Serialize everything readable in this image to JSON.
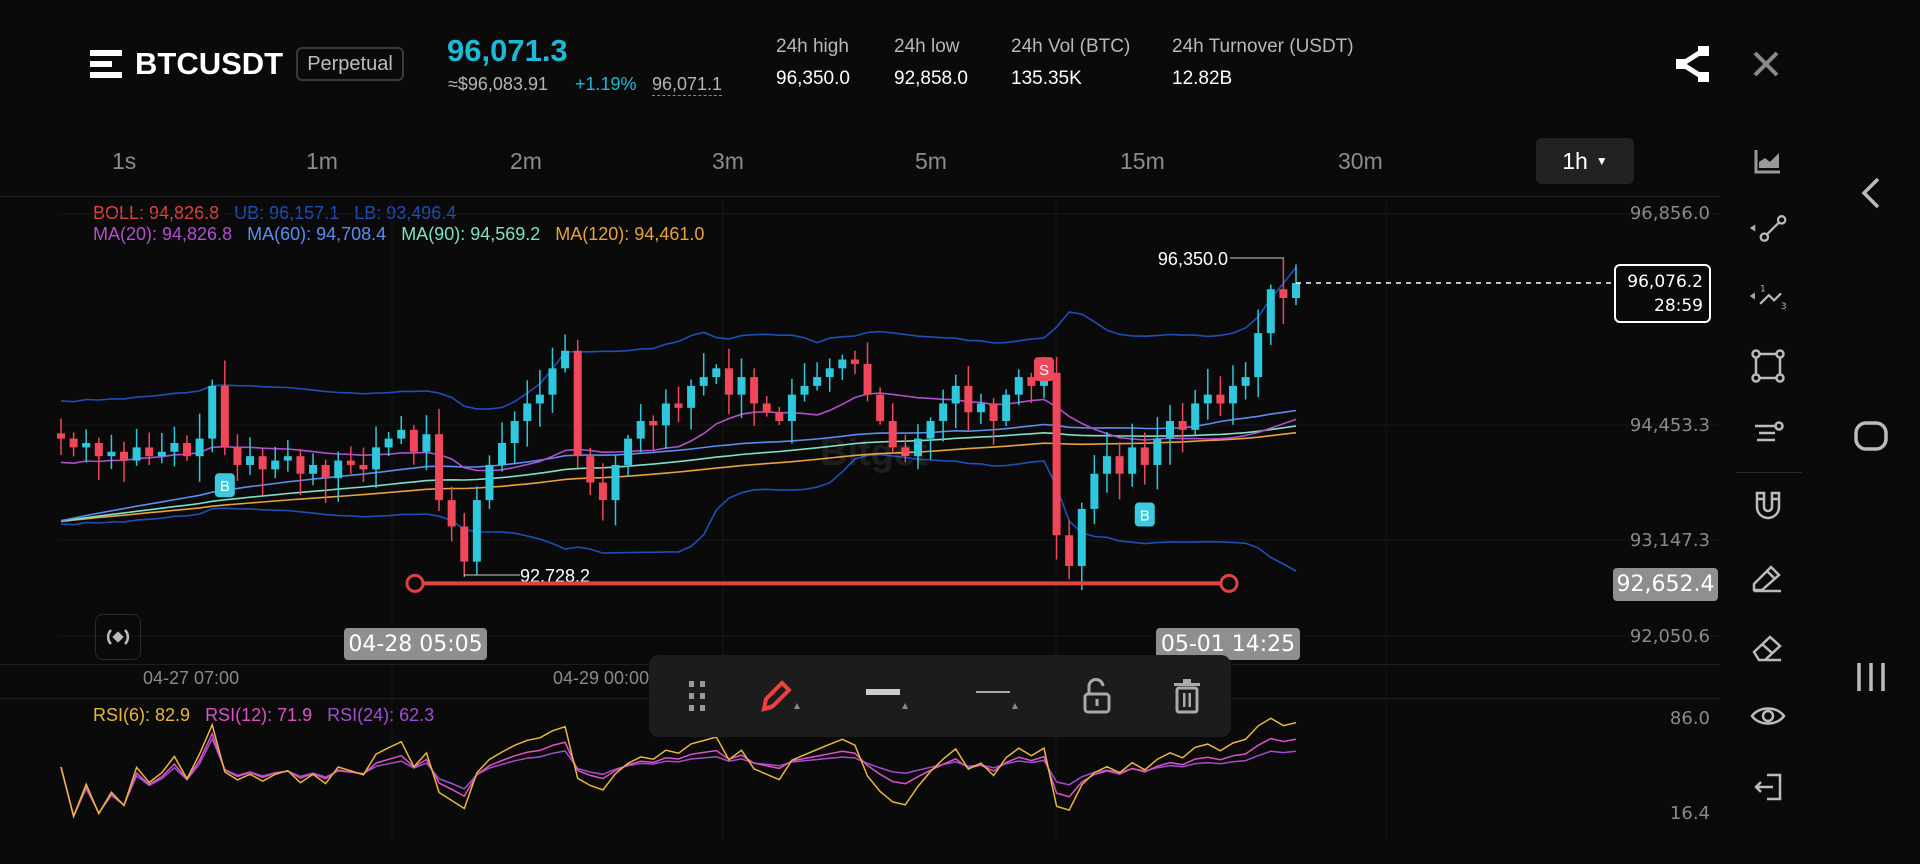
{
  "header": {
    "symbol": "BTCUSDT",
    "contract_type": "Perpetual",
    "last_price": "96,071.3",
    "usd_price": "≈$96,083.91",
    "change_pct": "+1.19%",
    "mark_price": "96,071.1",
    "stats": [
      {
        "label": "24h high",
        "value": "96,350.0"
      },
      {
        "label": "24h low",
        "value": "92,858.0"
      },
      {
        "label": "24h Vol (BTC)",
        "value": "135.35K"
      },
      {
        "label": "24h Turnover (USDT)",
        "value": "12.82B"
      }
    ],
    "icons": [
      "menu-icon",
      "share-icon",
      "close-icon"
    ]
  },
  "timeframes": [
    "1s",
    "1m",
    "2m",
    "3m",
    "5m",
    "15m",
    "30m"
  ],
  "selected_timeframe": "1h",
  "indicators": {
    "boll": {
      "label": "BOLL: 94,826.8",
      "ub": "UB: 96,157.1",
      "lb": "LB: 93,496.4"
    },
    "ma": [
      "MA(20): 94,826.8",
      "MA(60): 94,708.4",
      "MA(90): 94,569.2",
      "MA(120): 94,461.0"
    ],
    "rsi": [
      "RSI(6): 82.9",
      "RSI(12): 71.9",
      "RSI(24): 62.3"
    ]
  },
  "colors": {
    "up": "#2fc7dc",
    "down": "#f0475a",
    "boll": "#e0433f",
    "ub": "#1f4fb8",
    "ma20": "#b04fd0",
    "ma60": "#5b8cf0",
    "ma90": "#7fe0c8",
    "ma120": "#e8a23a",
    "rsi6": "#e8b83a",
    "rsi12": "#e052c8",
    "rsi24": "#a04fd0",
    "accent": "#1db9d6"
  },
  "price_axis": [
    "96,856.0",
    "94,453.3",
    "93,147.3",
    "92,050.6"
  ],
  "rsi_axis": [
    "86.0",
    "16.4"
  ],
  "time_axis": [
    "04-27 07:00",
    "04-29 00:00"
  ],
  "current_price_box": {
    "price": "96,076.2",
    "countdown": "28:59"
  },
  "crosshair_price": "92,652.4",
  "range_dates": [
    "04-28 05:05",
    "05-01 14:25"
  ],
  "watermark": "Bitget",
  "chart_data": {
    "type": "candlestick",
    "interval": "1h",
    "ylim": [
      91900,
      96950
    ],
    "closes": [
      94300,
      94200,
      94250,
      94100,
      94150,
      94050,
      94200,
      94100,
      94150,
      94250,
      94100,
      94300,
      94900,
      94200,
      94000,
      94100,
      93950,
      94050,
      94100,
      93900,
      94000,
      93850,
      94050,
      94000,
      93950,
      94200,
      94300,
      94400,
      94150,
      94350,
      93600,
      93300,
      92900,
      93600,
      94000,
      94250,
      94500,
      94700,
      94800,
      95100,
      95300,
      94100,
      93800,
      93600,
      94000,
      94300,
      94500,
      94450,
      94700,
      94650,
      94900,
      95000,
      95100,
      94800,
      95000,
      94700,
      94600,
      94500,
      94800,
      94900,
      95000,
      95100,
      95200,
      95150,
      94800,
      94500,
      94200,
      94100,
      94300,
      94500,
      94700,
      94900,
      94600,
      94700,
      94500,
      94800,
      95000,
      94900,
      95050,
      93200,
      92850,
      93500,
      93900,
      94100,
      93900,
      94200,
      94000,
      94300,
      94500,
      94400,
      94700,
      94800,
      94700,
      94900,
      95000,
      95500,
      96000,
      95900,
      96071.3
    ],
    "high_marker": {
      "index": 97,
      "value": 96350.0,
      "label": "96,350.0"
    },
    "low_marker": {
      "index": 32,
      "value": 92728.2,
      "label": "92,728.2"
    },
    "signals": [
      {
        "index": 13,
        "type": "B"
      },
      {
        "index": 78,
        "type": "S"
      },
      {
        "index": 86,
        "type": "B"
      }
    ],
    "horizontal_line": {
      "price": 92652.4
    },
    "rsi_ylim": [
      16.4,
      86.0
    ]
  },
  "drawing_toolbar": [
    "drag-handle",
    "pencil",
    "line-width",
    "line-style",
    "unlock",
    "delete"
  ]
}
